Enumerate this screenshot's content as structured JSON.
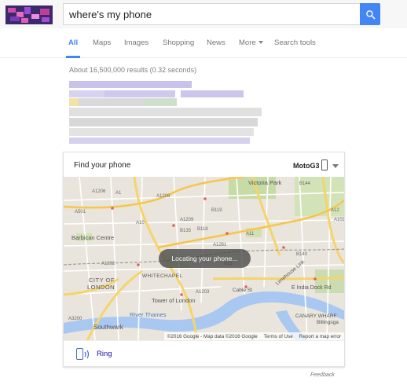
{
  "search": {
    "query": "where's my phone"
  },
  "tabs": [
    {
      "label": "All",
      "active": true
    },
    {
      "label": "Maps",
      "active": false
    },
    {
      "label": "Images",
      "active": false
    },
    {
      "label": "Shopping",
      "active": false
    },
    {
      "label": "News",
      "active": false
    },
    {
      "label": "More",
      "active": false
    },
    {
      "label": "Search tools",
      "active": false
    }
  ],
  "stats": "About 16,500,000 results (0.32 seconds)",
  "card": {
    "title": "Find your phone",
    "device": "MotoG3",
    "locating_text": "Locating your phone...",
    "ring_label": "Ring",
    "map_labels": [
      "Victoria Park",
      "Barbican Centre",
      "CITY OF",
      "LONDON",
      "WHITECHAPEL",
      "Tower of London",
      "River Thames",
      "Southwark",
      "E India Dock Rd",
      "Limehouse Link",
      "Cable St",
      "CANARY WHARF",
      "Billingsga"
    ],
    "road_labels": [
      "A501",
      "A1208",
      "A1209",
      "B135",
      "B119",
      "A11",
      "A13",
      "A1203",
      "A3200",
      "A1206",
      "A102",
      "B140",
      "A12",
      "A10",
      "A1202",
      "B118",
      "B144",
      "A1261",
      "A1"
    ],
    "attribution": {
      "data": "©2016 Google - Map data ©2016 Google",
      "terms": "Terms of Use",
      "report": "Report a map error"
    }
  },
  "feedback": "Feedback",
  "colors": {
    "accent": "#4285f4",
    "link": "#1a0dab",
    "ring_icon": "#4a67d8"
  }
}
